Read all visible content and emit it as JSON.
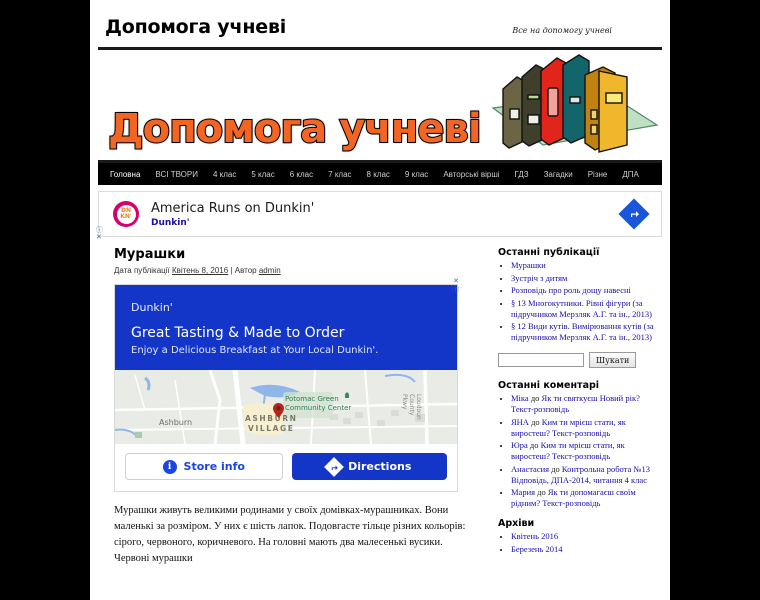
{
  "site": {
    "title": "Допомога учневі",
    "tagline": "Все на допомогу учневі",
    "banner_logo": "Допомога учневі"
  },
  "nav": {
    "items": [
      {
        "label": "Головна",
        "active": true
      },
      {
        "label": "ВСІ ТВОРИ",
        "active": false
      },
      {
        "label": "4 клас",
        "active": false
      },
      {
        "label": "5 клас",
        "active": false
      },
      {
        "label": "6 клас",
        "active": false
      },
      {
        "label": "7 клас",
        "active": false
      },
      {
        "label": "8 клас",
        "active": false
      },
      {
        "label": "9 клас",
        "active": false
      },
      {
        "label": "Авторські вірші",
        "active": false
      },
      {
        "label": "ГДЗ",
        "active": false
      },
      {
        "label": "Загадки",
        "active": false
      },
      {
        "label": "Різне",
        "active": false
      },
      {
        "label": "ДПА",
        "active": false
      }
    ]
  },
  "top_ad": {
    "logo_line1": "DN",
    "logo_line2": "KN'",
    "headline": "America Runs on Dunkin'",
    "advertiser": "Dunkin'",
    "adchoices_info": "ⓘ",
    "adchoices_close": "✕"
  },
  "post": {
    "title": "Мурашки",
    "meta_prefix": "Дата публікації",
    "date": "Квітень 8, 2016",
    "meta_separator": "|",
    "author_prefix": "Автор",
    "author": "admin",
    "body": "Мурашки живуть великими родинами у своїх домівках-мурашниках. Вони маленькі за розміром. У них є шість лапок. Подовгасте тільце різних кольорів: сірого, червоного, коричневого. На головні мають два малесенькі вусики. Червоні мурашки"
  },
  "article_ad": {
    "close_x": "✕",
    "info_i": "ⓘ",
    "brand": "Dunkin'",
    "headline": "Great Tasting & Made to Order",
    "description": "Enjoy a Delicious Breakfast at Your Local Dunkin'.",
    "map": {
      "city_label": "Ashburn",
      "area_label_line1": "ASHBURN",
      "area_label_line2": "VILLAGE",
      "poi_line1": "Potomac Green",
      "poi_line2": "Community Center",
      "road_label": "Loudoun County Pkwy"
    },
    "buttons": {
      "store_info": "Store info",
      "directions": "Directions",
      "info_icon": "i"
    }
  },
  "sidebar": {
    "recent_posts": {
      "title": "Останні публікації",
      "items": [
        "Мурашки",
        "Зустріч з дитям",
        "Розповідь про роль дощу навесні",
        "§ 13 Многокутники. Рівні фігури (за підручником Мерзляк А.Г. та ін., 2013)",
        "§ 12 Види кутів. Вимірювання кутів (за підручником Мерзляк А.Г. та ін., 2013)"
      ]
    },
    "search": {
      "value": "",
      "placeholder": "",
      "button_label": "Шукати"
    },
    "recent_comments": {
      "title": "Останні коментарі",
      "items": [
        {
          "author": "Міка",
          "connector": "до",
          "post": "Як ти святкуєш Новий рік? Текст-розповідь"
        },
        {
          "author": "ЯНА",
          "connector": "до",
          "post": "Ким ти мрієш стати, як виростеш? Текст-розповідь"
        },
        {
          "author": "Юра",
          "connector": "до",
          "post": "Ким ти мрієш стати, як виростеш? Текст-розповідь"
        },
        {
          "author": "Анастасия",
          "connector": "до",
          "post": "Контрольна робота №13 Відповідь, ДПА-2014, читання 4 клас"
        },
        {
          "author": "Мария",
          "connector": "до",
          "post": "Як ти допомагаєш своїм рідним? Текст-розповідь"
        }
      ]
    },
    "archives": {
      "title": "Архіви",
      "items": [
        "Квітень 2016",
        "Березень 2014"
      ]
    }
  }
}
